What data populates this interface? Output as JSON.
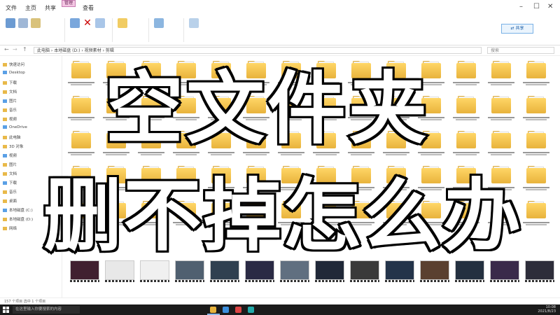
{
  "ribbon": {
    "tabs": [
      "文件",
      "主页",
      "共享",
      "查看"
    ],
    "context_tab": "管理",
    "share_button": "⇄ 共享"
  },
  "window_controls": [
    "–",
    "☐",
    "✕"
  ],
  "address": {
    "path": "此电脑 › 本地磁盘 (D:) › 视频素材 › 剪辑",
    "search_placeholder": "搜索"
  },
  "nav": {
    "items": [
      "快速访问",
      "Desktop",
      "下载",
      "文档",
      "图片",
      "音乐",
      "视频",
      "OneDrive",
      "此电脑",
      "3D 对象",
      "视频",
      "图片",
      "文档",
      "下载",
      "音乐",
      "桌面",
      "本地磁盘 (C:)",
      "本地磁盘 (D:)",
      "网络"
    ]
  },
  "overlay": {
    "line1": "空文件夹",
    "line2": "删不掉怎么办"
  },
  "status": {
    "text": "157 个项目    选中 1 个项目"
  },
  "taskbar": {
    "search_placeholder": "在这里输入你要搜索的内容",
    "time": "10:08",
    "date": "2021/8/23"
  }
}
